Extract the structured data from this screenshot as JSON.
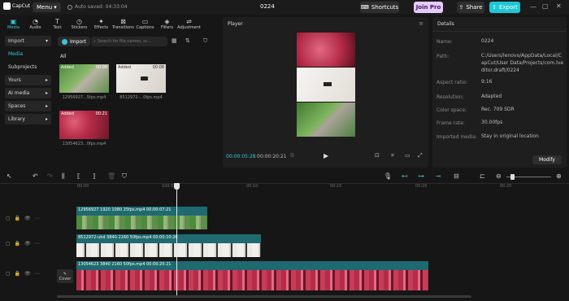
{
  "app": {
    "logo": "CapCut",
    "menu_label": "Menu",
    "autosave": "Auto saved: 04:33:04",
    "project_title": "0224"
  },
  "top_actions": {
    "shortcuts": "Shortcuts",
    "join_pro": "Join Pro",
    "share": "Share",
    "export": "Export"
  },
  "tools": [
    "Media",
    "Audio",
    "Text",
    "Stickers",
    "Effects",
    "Transitions",
    "Captions",
    "Filters",
    "Adjustment"
  ],
  "sidebar": [
    "Import",
    "Media",
    "Subprojects",
    "Yours",
    "AI media",
    "Spaces",
    "Library"
  ],
  "media": {
    "import_label": "Import",
    "search_placeholder": "Search for file names, sc...",
    "all_label": "All",
    "clips": [
      {
        "tag": "Added",
        "duration": "00:08",
        "name": "12956927...5fps.mp4",
        "color": "#6f9c5d"
      },
      {
        "tag": "Added",
        "duration": "00:08",
        "name": "8512972-...0fps.mp4",
        "color": "#e9e6e1"
      },
      {
        "tag": "Added",
        "duration": "00:21",
        "name": "13054623...0fps.mp4",
        "color": "#c23a55"
      }
    ]
  },
  "player": {
    "title": "Player",
    "current_time": "00:00:05:28",
    "total_time": "00:00:20:21"
  },
  "details": {
    "title": "Details",
    "rows": [
      {
        "label": "Name:",
        "value": "0224"
      },
      {
        "label": "Path:",
        "value": "C:/Users/lenovo/AppData/Local/CapCut/User Data/Projects/com.lveditor.draft/0224"
      },
      {
        "label": "Aspect ratio:",
        "value": "9:16"
      },
      {
        "label": "Resolution:",
        "value": "Adapted"
      },
      {
        "label": "Color space:",
        "value": "Rec. 709 SDR"
      },
      {
        "label": "Frame rate:",
        "value": "30.00fps"
      },
      {
        "label": "Imported media:",
        "value": "Stay in original location"
      }
    ],
    "modify_label": "Modify"
  },
  "timeline": {
    "ruler_labels": [
      "00:00",
      "100:05",
      "00:10",
      "00:15",
      "00:20",
      "00:25"
    ],
    "cover_label": "Cover",
    "tracks": [
      {
        "label": "12956927  1920  1080  25fps.mp4   00:00:07:21",
        "color": "#5b8f4d"
      },
      {
        "label": "8512972-uhd  3840  2160  50fps.mp4   00:00:10:26",
        "color": "#dcdcdc"
      },
      {
        "label": "13054623  3840  2160  50fps.mp4   00:00:20:21",
        "color": "#b8324e"
      }
    ]
  },
  "colors": {
    "accent": "#3bc6d6",
    "track_teal": "#1e6a70",
    "join_pro_bg": "#e7c9ff",
    "export_bg": "#1fc7d4"
  }
}
